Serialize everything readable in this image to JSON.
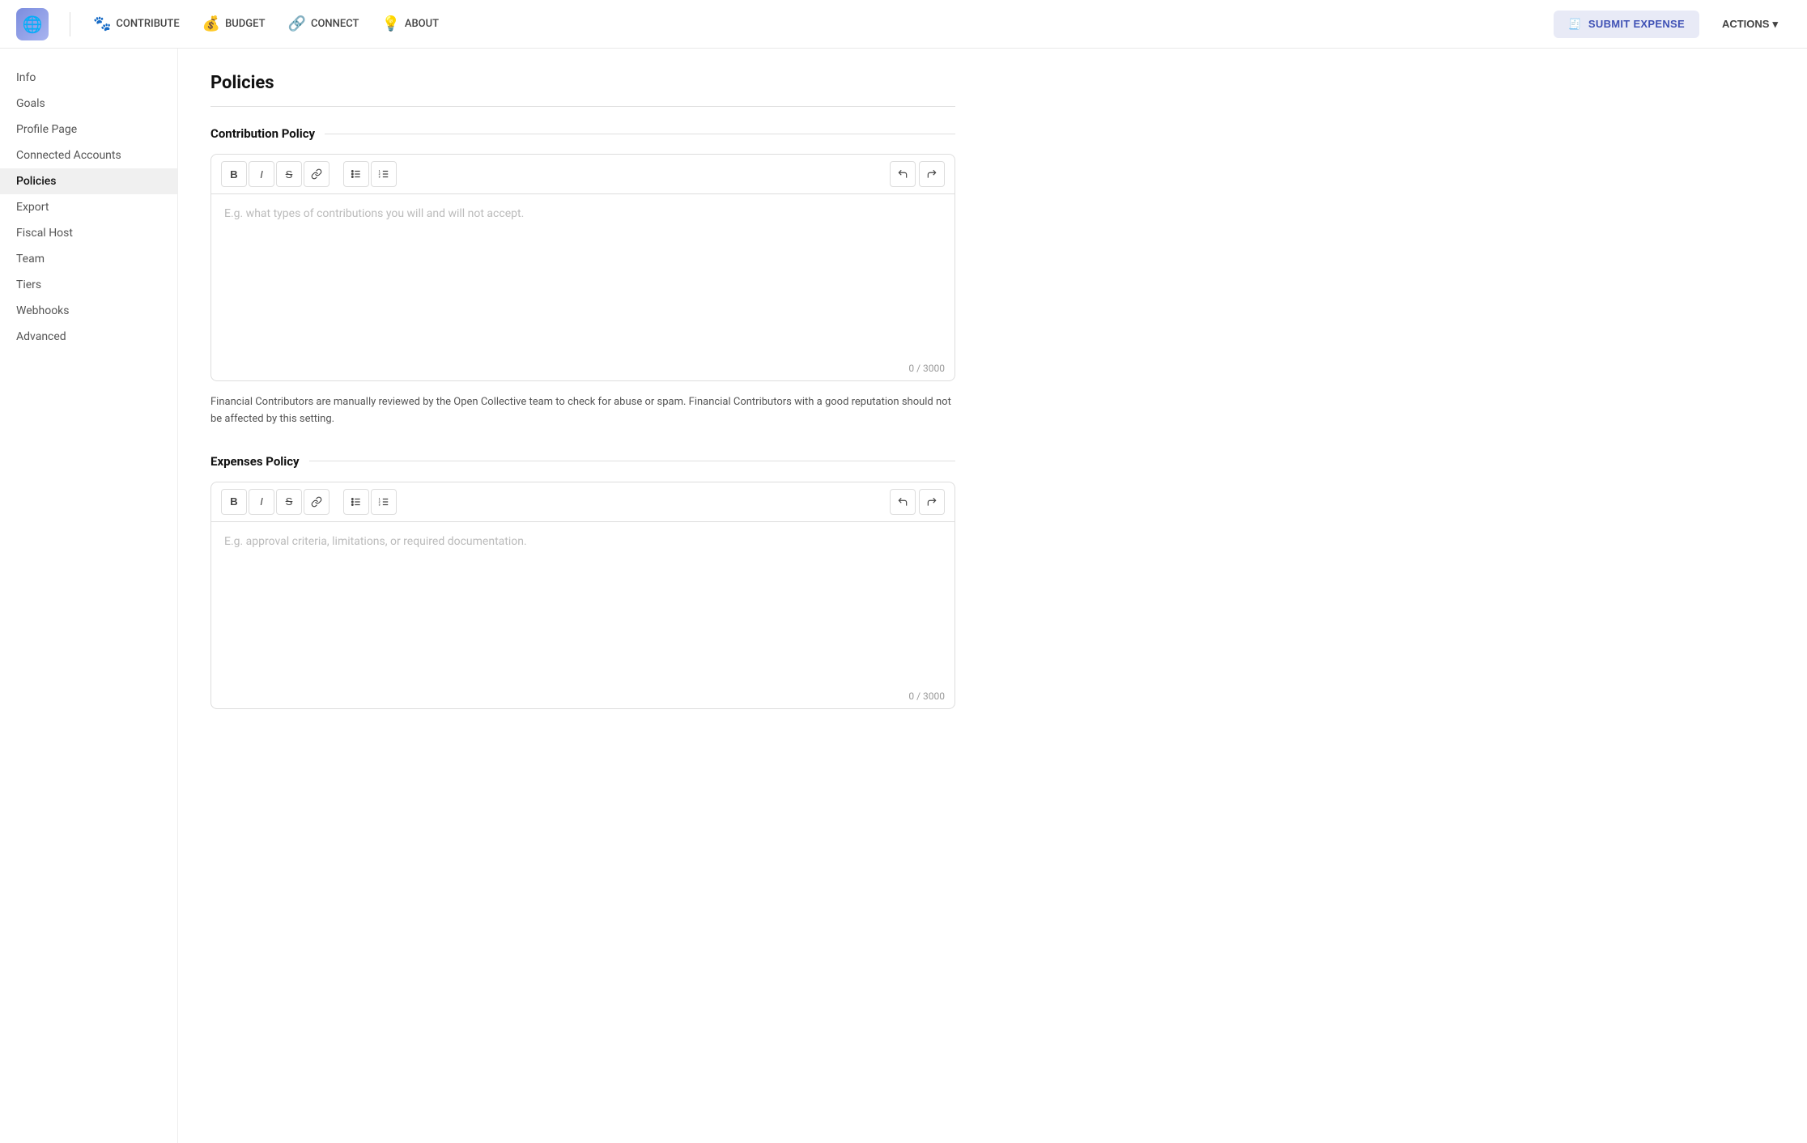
{
  "header": {
    "logo_emoji": "🌐",
    "nav": [
      {
        "id": "contribute",
        "label": "CONTRIBUTE",
        "icon": "🐾"
      },
      {
        "id": "budget",
        "label": "BUDGET",
        "icon": "💰"
      },
      {
        "id": "connect",
        "label": "CONNECT",
        "icon": "🔗"
      },
      {
        "id": "about",
        "label": "ABOUT",
        "icon": "💡"
      }
    ],
    "submit_expense_label": "SUBMIT EXPENSE",
    "actions_label": "ACTIONS"
  },
  "sidebar": {
    "items": [
      {
        "id": "info",
        "label": "Info"
      },
      {
        "id": "goals",
        "label": "Goals"
      },
      {
        "id": "profile-page",
        "label": "Profile Page"
      },
      {
        "id": "connected-accounts",
        "label": "Connected Accounts"
      },
      {
        "id": "policies",
        "label": "Policies",
        "active": true
      },
      {
        "id": "export",
        "label": "Export"
      },
      {
        "id": "fiscal-host",
        "label": "Fiscal Host"
      },
      {
        "id": "team",
        "label": "Team"
      },
      {
        "id": "tiers",
        "label": "Tiers"
      },
      {
        "id": "webhooks",
        "label": "Webhooks"
      },
      {
        "id": "advanced",
        "label": "Advanced"
      }
    ]
  },
  "main": {
    "page_title": "Policies",
    "contribution_policy": {
      "section_title": "Contribution Policy",
      "placeholder": "E.g. what types of contributions you will and will not accept.",
      "counter": "0 / 3000",
      "description": "Financial Contributors are manually reviewed by the Open Collective team to check for abuse or spam. Financial Contributors with a good reputation should not be affected by this setting."
    },
    "expenses_policy": {
      "section_title": "Expenses Policy",
      "placeholder": "E.g. approval criteria, limitations, or required documentation.",
      "counter": "0 / 3000"
    }
  },
  "toolbar": {
    "bold": "B",
    "italic": "I",
    "strikethrough": "S",
    "link": "🔗",
    "bullet_list": "•≡",
    "ordered_list": "1≡",
    "undo": "↩",
    "redo": "↪"
  }
}
